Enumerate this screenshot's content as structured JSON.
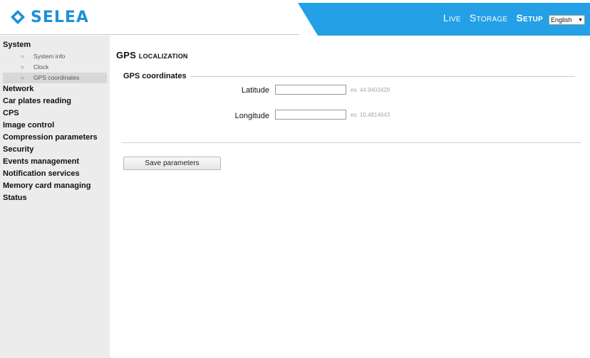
{
  "brand": {
    "name": "SELEA",
    "color": "#1e90d8"
  },
  "topnav": {
    "items": [
      {
        "label": "Live",
        "active": false
      },
      {
        "label": "Storage",
        "active": false
      },
      {
        "label": "Setup",
        "active": true
      }
    ],
    "language": {
      "selected": "English"
    },
    "band_color": "#23a0e6"
  },
  "sidebar": {
    "system": {
      "label": "System",
      "children": [
        {
          "label": "System info"
        },
        {
          "label": "Clock"
        },
        {
          "label": "GPS coordinates",
          "active": true
        }
      ]
    },
    "items": [
      {
        "label": "Network"
      },
      {
        "label": "Car plates reading"
      },
      {
        "label": "CPS"
      },
      {
        "label": "Image control"
      },
      {
        "label": "Compression parameters"
      },
      {
        "label": "Security"
      },
      {
        "label": "Events management"
      },
      {
        "label": "Notification services"
      },
      {
        "label": "Memory card managing"
      },
      {
        "label": "Status"
      }
    ]
  },
  "main": {
    "title": "GPS localization",
    "fieldset_legend": "GPS coordinates",
    "latitude": {
      "label": "Latitude",
      "value": "",
      "hint": "es. 44.9403428"
    },
    "longitude": {
      "label": "Longitude",
      "value": "",
      "hint": "es. 10.4814643"
    },
    "save_label": "Save parameters"
  }
}
